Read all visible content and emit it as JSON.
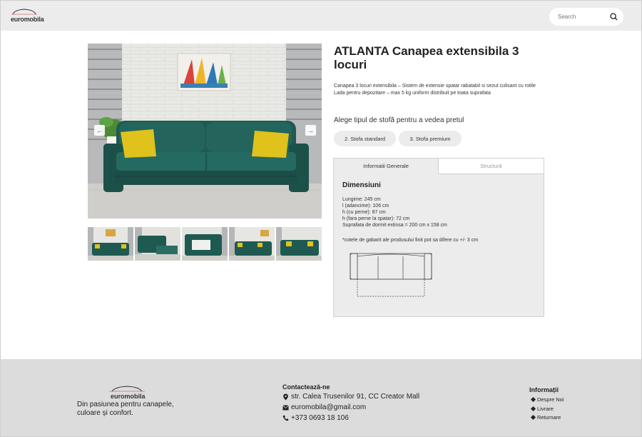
{
  "header": {
    "logo_text": "euromobila",
    "search_placeholder": "Search"
  },
  "product": {
    "title": "ATLANTA Canapea extensibila 3 locuri",
    "description_lines": [
      "Canapea 3 locuri extensibila – Sistem de extensie spatar rabatabil si sezut culisant cu rotile",
      "Lada pentru depozitare – max 5 kg uniform distribuit pe toata suprafata"
    ],
    "choose_label": "Alege tipul de stofă pentru a vedea pretul",
    "fabric_options": [
      "2. Stofa standard",
      "3. Stofa premium"
    ]
  },
  "tabs": {
    "general": "Informatii Generale",
    "structure": "Structură"
  },
  "dimensions": {
    "title": "Dimensiuni",
    "lines": [
      "Lungime: 245 cm",
      "l (adancime): 106 cm",
      "h (cu perne): 87 cm",
      "h (fara perne la spatar): 72 cm",
      "Suprafata de dormit extinsa = 200 cm x 158 cm"
    ],
    "note": "*cotele de gabarit ale produsului finit pot sa difere cu +/- 3 cm"
  },
  "footer": {
    "logo_text": "euromobila",
    "tagline": "Din pasiunea pentru canapele, culoare și confort.",
    "contact_title": "Contactează-ne",
    "address": "str. Calea Trusenilor 91, CC Creator Mall",
    "email": "euromobila@gmail.com",
    "phone": "+373 0693 18 106",
    "info_title": "Informații",
    "info_items": [
      "Despre Noi",
      "Livrare",
      "Returnare"
    ]
  },
  "colors": {
    "sofa": "#1f5a52",
    "pillow": "#e0c21c",
    "header_bg": "#ececec",
    "footer_bg": "#dcdcdc"
  }
}
